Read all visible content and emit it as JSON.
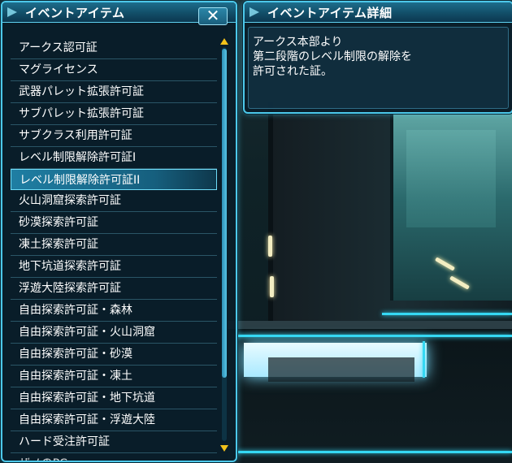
{
  "list_window": {
    "title": "イベントアイテム",
    "close_label": "✕",
    "items": [
      "アークス認可証",
      "マグライセンス",
      "武器パレット拡張許可証",
      "サブパレット拡張許可証",
      "サブクラス利用許可証",
      "レベル制限解除許可証I",
      "レベル制限解除許可証II",
      "火山洞窟探索許可証",
      "砂漠探索許可証",
      "凍土探索許可証",
      "地下坑道探索許可証",
      "浮遊大陸探索許可証",
      "自由探索許可証・森林",
      "自由探索許可証・火山洞窟",
      "自由探索許可証・砂漠",
      "自由探索許可証・凍土",
      "自由探索許可証・地下坑道",
      "自由探索許可証・浮遊大陸",
      "ハード受注許可証",
      "ザノのPC"
    ],
    "selected_index": 6
  },
  "detail_window": {
    "title": "イベントアイテム詳細",
    "lines": [
      "アークス本部より",
      "第二段階のレベル制限の解除を",
      "許可された証。"
    ]
  },
  "colors": {
    "frame": "#4cc8ea",
    "title_bar": "#124e68",
    "selected_row": "#1f7ea3",
    "scroll_arrow": "#f2c21a"
  },
  "icons": {
    "title_accent": "diamond-accent-icon",
    "close": "close-icon",
    "scroll_up": "triangle-up-icon",
    "scroll_down": "triangle-down-icon"
  }
}
